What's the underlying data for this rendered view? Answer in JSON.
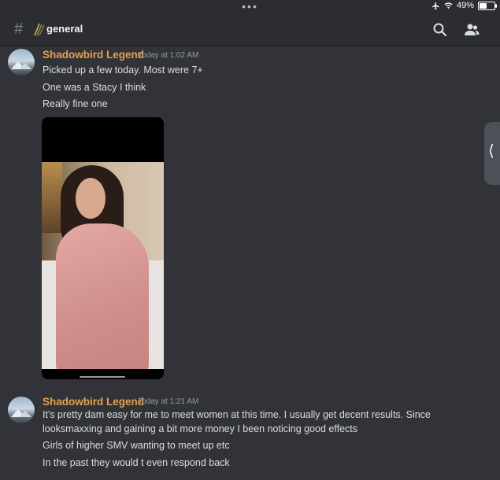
{
  "status_bar": {
    "dots": "•••",
    "battery": "49%",
    "battery_level": 0.49,
    "icons": [
      "airplane-icon",
      "wifi-icon",
      "battery-icon"
    ]
  },
  "header": {
    "channel_name": "general",
    "icons": [
      "hash-icon",
      "search-icon",
      "members-icon"
    ]
  },
  "messages": [
    {
      "author": "Shadowbird Legend",
      "timestamp": "Today at 1:02 AM",
      "lines": [
        "Picked up a few today. Most were 7+",
        "One was a Stacy I think",
        "Really fine one"
      ],
      "attachment": "image"
    },
    {
      "author": "Shadowbird Legend",
      "timestamp": "Today at 1:21 AM",
      "lines": [
        "It's pretty dam easy for me to meet women at this time. I usually get decent results. Since",
        "looksmaxxing and gaining a bit more money I been noticing good effects",
        "Girls of higher SMV wanting to meet up etc",
        "In the past they would t even respond back"
      ]
    }
  ],
  "colors": {
    "background": "#313338",
    "header": "#2b2d31",
    "author": "#e6a04a",
    "text": "#dbdee1",
    "timestamp": "#949ba4"
  }
}
